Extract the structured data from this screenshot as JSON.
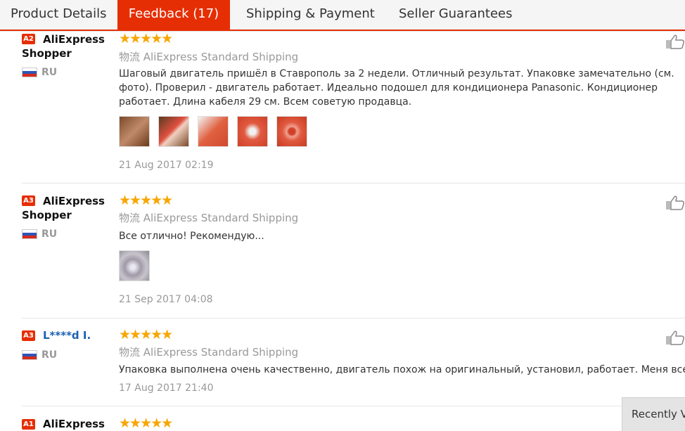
{
  "tabs": [
    {
      "label": "Product Details"
    },
    {
      "label": "Feedback (17)"
    },
    {
      "label": "Shipping & Payment"
    },
    {
      "label": "Seller Guarantees"
    }
  ],
  "stars": "★★★★★",
  "reviews": [
    {
      "level": "A2",
      "name": "AliExpress Shopper",
      "country": "RU",
      "shipping_prefix": "物流",
      "shipping": "AliExpress Standard Shipping",
      "text": "Шаговый двигатель пришёл в Ставрополь за 2 недели. Отличный результат. Упаковке замечательно (см. фото). Проверил - двигатель работает. Идеально подошел для кондиционера Panasonic. Кондиционер работает. Длина кабеля 29 см. Всем советую продавца.",
      "date": "21 Aug 2017 02:19",
      "photos": 5
    },
    {
      "level": "A3",
      "name": "AliExpress Shopper",
      "country": "RU",
      "shipping_prefix": "物流",
      "shipping": "AliExpress Standard Shipping",
      "text": "Все отлично! Рекомендую...",
      "date": "21 Sep 2017 04:08",
      "photos": 1
    },
    {
      "level": "A3",
      "name": "L****d I.",
      "country": "RU",
      "shipping_prefix": "物流",
      "shipping": "AliExpress Standard Shipping",
      "text": "Упаковка выполнена очень качественно, двигатель похож на оригинальный, установил, работает. Меня все устроило",
      "date": "17 Aug 2017 21:40",
      "photos": 0
    },
    {
      "level": "A1",
      "name": "AliExpress",
      "country": "",
      "shipping_prefix": "",
      "shipping": "",
      "text": "",
      "date": "",
      "photos": 0
    }
  ],
  "recently_viewed": "Recently Viewed",
  "colors": {
    "accent": "#e62e04",
    "star": "#f8a602"
  }
}
